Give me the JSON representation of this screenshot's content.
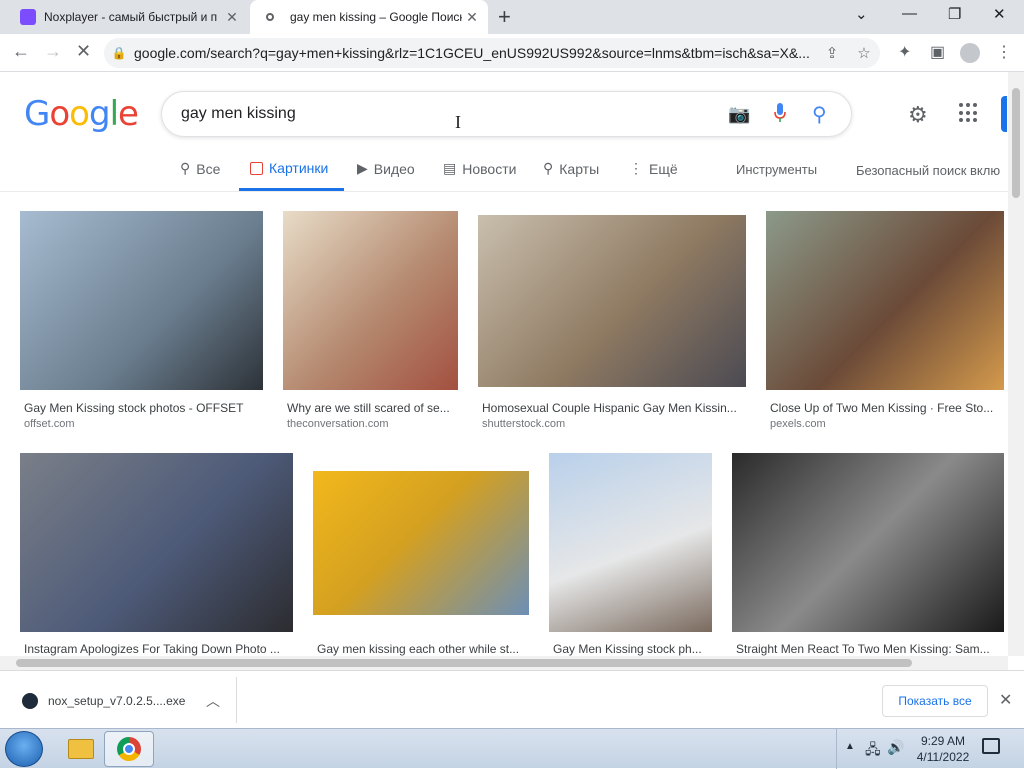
{
  "browser": {
    "tabs": [
      {
        "title": "Noxplayer - самый быстрый и п",
        "active": false,
        "favicon_color": "#7c4dff"
      },
      {
        "title": "gay men kissing – Google Поиск",
        "active": true,
        "favicon_color": "#4285f4"
      }
    ],
    "url": "google.com/search?q=gay+men+kissing&rlz=1C1GCEU_enUS992US992&source=lnms&tbm=isch&sa=X&...",
    "new_tab_glyph": "+",
    "window_controls": {
      "minimize": "—",
      "maximize": "❐",
      "close": "✕",
      "tab_menu": "⌄"
    }
  },
  "google": {
    "logo": [
      {
        "ch": "G",
        "color": "#4285f4"
      },
      {
        "ch": "o",
        "color": "#ea4335"
      },
      {
        "ch": "o",
        "color": "#fbbc05"
      },
      {
        "ch": "g",
        "color": "#4285f4"
      },
      {
        "ch": "l",
        "color": "#34a853"
      },
      {
        "ch": "e",
        "color": "#ea4335"
      }
    ],
    "query": "gay men kissing",
    "nav_tabs": [
      {
        "label": "Все",
        "icon": "search-icon",
        "active": false
      },
      {
        "label": "Картинки",
        "icon": "image-icon",
        "active": true
      },
      {
        "label": "Видео",
        "icon": "video-icon",
        "active": false
      },
      {
        "label": "Новости",
        "icon": "news-icon",
        "active": false
      },
      {
        "label": "Карты",
        "icon": "location-pin-icon",
        "active": false
      },
      {
        "label": "Ещё",
        "icon": "more-vert-icon",
        "active": false
      }
    ],
    "tools_label": "Инструменты",
    "safesearch_label": "Безопасный поиск вклю",
    "results": [
      {
        "caption": "Gay Men Kissing stock photos - OFFSET",
        "source": "offset.com"
      },
      {
        "caption": "Why are we still scared of se...",
        "source": "theconversation.com"
      },
      {
        "caption": "Homosexual Couple Hispanic Gay Men Kissin...",
        "source": "shutterstock.com"
      },
      {
        "caption": "Close Up of Two Men Kissing · Free Sto...",
        "source": "pexels.com"
      },
      {
        "caption": "Instagram Apologizes For Taking Down Photo ...",
        "source": ""
      },
      {
        "caption": "Gay men kissing each other while st...",
        "source": ""
      },
      {
        "caption": "Gay Men Kissing stock ph...",
        "source": ""
      },
      {
        "caption": "Straight Men React To Two Men Kissing: Sam...",
        "source": ""
      }
    ]
  },
  "downloads": {
    "file": "nox_setup_v7.0.2.5....exe",
    "show_all": "Показать все"
  },
  "taskbar": {
    "time": "9:29 AM",
    "date": "4/11/2022"
  }
}
